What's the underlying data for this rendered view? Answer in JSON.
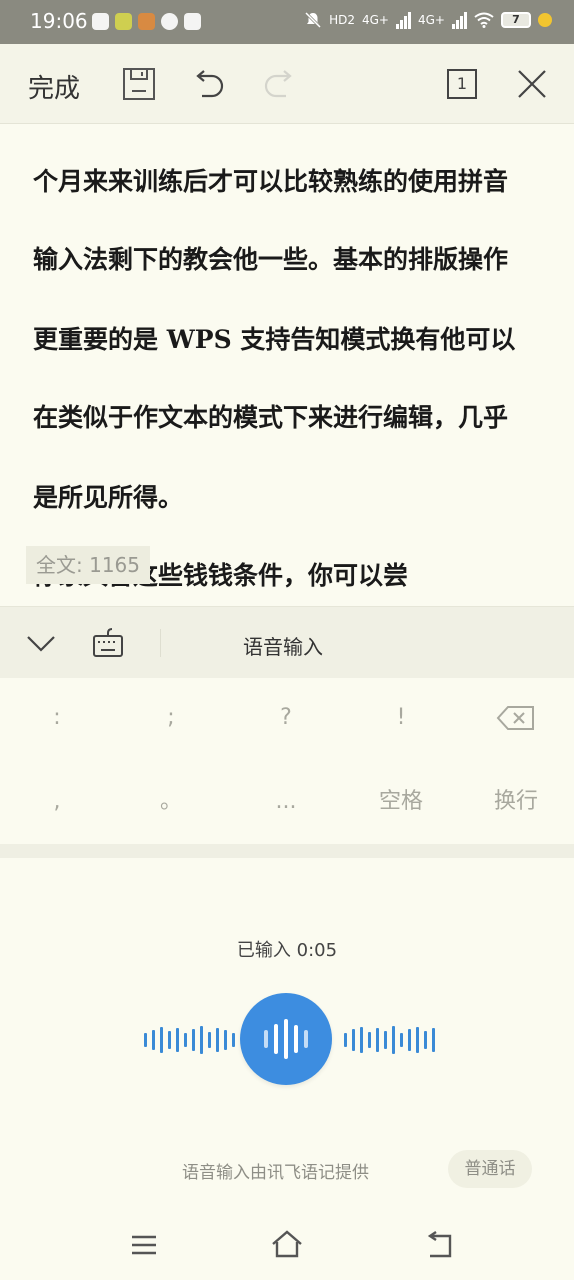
{
  "status_bar": {
    "time": "19:06",
    "net_labels": [
      "HD2",
      "4G+",
      "4G+"
    ],
    "battery": "7"
  },
  "toolbar": {
    "done_label": "完成",
    "page_badge": "1"
  },
  "document": {
    "lines": [
      "个月来来训练后才可以比较熟练的使用拼音",
      "输入法剩下的教会他一些。基本的排版操作",
      "更重要的是 WPS 支持告知模式换有他可以",
      "在类似于作文本的模式下来进行编辑，几乎",
      "是所见所得。",
      "你家具备这些钱钱条件，你可以尝"
    ],
    "word_count": "全文: 1165"
  },
  "keyboard": {
    "voice_tab_label": "语音输入",
    "row1": [
      ":",
      ";",
      "?",
      "!"
    ],
    "row2": [
      ",",
      "。",
      "...",
      "空格",
      "换行"
    ]
  },
  "voice": {
    "status": "已输入 0:05",
    "provider_text": "语音输入由讯飞语记提供",
    "language_button": "普通话"
  },
  "colors": {
    "accent": "#3d8de0",
    "background": "#fbfbf0",
    "status_bar": "#8a8a80"
  }
}
